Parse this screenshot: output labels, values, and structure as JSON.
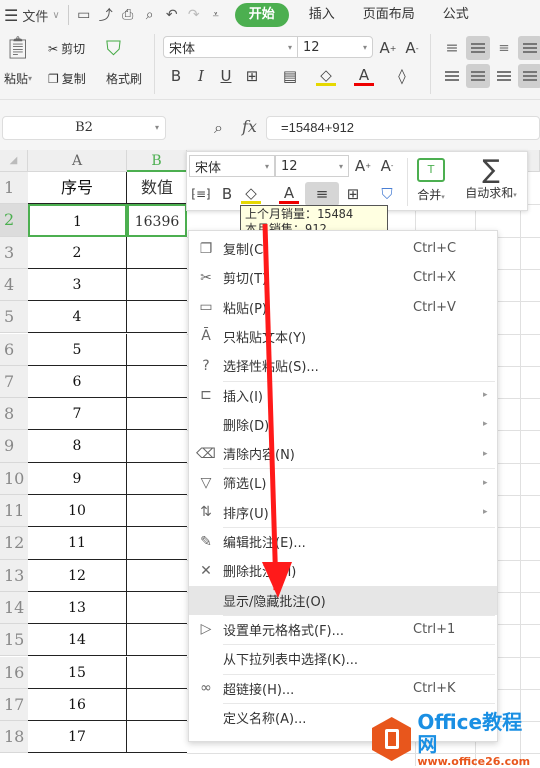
{
  "topbar": {
    "menu_label": "文件",
    "tabs": [
      {
        "label": "开始",
        "active": true
      },
      {
        "label": "插入",
        "active": false
      },
      {
        "label": "页面布局",
        "active": false
      },
      {
        "label": "公式",
        "active": false
      }
    ]
  },
  "ribbon": {
    "paste_label": "粘贴",
    "cut_label": "剪切",
    "copy_label": "复制",
    "format_painter_label": "格式刷",
    "font_name": "宋体",
    "font_size": "12",
    "bold": "B",
    "italic": "I",
    "underline": "U"
  },
  "formula_bar": {
    "cell_ref": "B2",
    "fx": "fx",
    "formula": "=15484+912"
  },
  "sheet": {
    "columns": [
      "A",
      "B"
    ],
    "rows": [
      "1",
      "2",
      "3",
      "4",
      "5",
      "6",
      "7",
      "8",
      "9",
      "10",
      "11",
      "12",
      "13",
      "14",
      "15",
      "16",
      "17",
      "18"
    ],
    "header_a": "序号",
    "header_b": "数值",
    "a_values": [
      "1",
      "2",
      "3",
      "4",
      "5",
      "6",
      "7",
      "8",
      "9",
      "10",
      "11",
      "12",
      "13",
      "14",
      "15",
      "16",
      "17"
    ],
    "b2_value": "16396",
    "selected_cell": "B2"
  },
  "mini_toolbar": {
    "font_name": "宋体",
    "font_size": "12",
    "bold": "B",
    "merge_label": "合并",
    "autosum_label": "自动求和"
  },
  "comment": {
    "line1": "上个月销量：15484",
    "line2": "本月销售：912"
  },
  "context_menu": {
    "items": [
      {
        "label": "复制(C)",
        "shortcut": "Ctrl+C",
        "icon": "copy-icon"
      },
      {
        "label": "剪切(T)",
        "shortcut": "Ctrl+X",
        "icon": "scissors-icon"
      },
      {
        "label": "粘贴(P)",
        "shortcut": "Ctrl+V",
        "icon": "paste-icon"
      },
      {
        "label": "只粘贴文本(Y)",
        "shortcut": "",
        "icon": "paste-text-icon"
      },
      {
        "label": "选择性粘贴(S)...",
        "shortcut": "",
        "icon": "paste-special-icon"
      },
      {
        "label": "插入(I)",
        "shortcut": "",
        "icon": "insert-icon",
        "submenu": true
      },
      {
        "label": "删除(D)",
        "shortcut": "",
        "icon": "",
        "submenu": true
      },
      {
        "label": "清除内容(N)",
        "shortcut": "",
        "icon": "eraser-icon",
        "submenu": true
      },
      {
        "label": "筛选(L)",
        "shortcut": "",
        "icon": "filter-icon",
        "submenu": true
      },
      {
        "label": "排序(U)",
        "shortcut": "",
        "icon": "sort-icon",
        "submenu": true
      },
      {
        "label": "编辑批注(E)...",
        "shortcut": "",
        "icon": "edit-comment-icon"
      },
      {
        "label": "删除批注(M)",
        "shortcut": "",
        "icon": "delete-comment-icon"
      },
      {
        "label": "显示/隐藏批注(O)",
        "shortcut": "",
        "icon": "",
        "highlighted": true
      },
      {
        "label": "设置单元格格式(F)...",
        "shortcut": "Ctrl+1",
        "icon": "format-cells-icon"
      },
      {
        "label": "从下拉列表中选择(K)...",
        "shortcut": "",
        "icon": ""
      },
      {
        "label": "超链接(H)...",
        "shortcut": "Ctrl+K",
        "icon": "link-icon"
      },
      {
        "label": "定义名称(A)...",
        "shortcut": "",
        "icon": ""
      }
    ]
  },
  "watermark": {
    "title": "Office教程网",
    "url": "www.office26.com"
  },
  "colors": {
    "accent_green": "#4caf50",
    "arrow_red": "#ff1a1a",
    "watermark_orange": "#e8561c",
    "watermark_blue": "#1a8fe3"
  }
}
